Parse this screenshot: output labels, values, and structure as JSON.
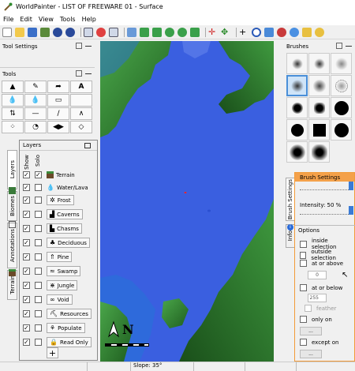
{
  "window": {
    "title": "WorldPainter - LIST OF FREEWARE 01 - Surface"
  },
  "menu": [
    "File",
    "Edit",
    "View",
    "Tools",
    "Help"
  ],
  "panels": {
    "tool_settings": "Tool Settings",
    "tools": "Tools",
    "layers": "Layers",
    "brushes": "Brushes",
    "brush_settings": "Brush Settings"
  },
  "side_tabs": {
    "layers": "Layers",
    "biomes": "Biomes",
    "annotations": "Annotations",
    "terrain": "Terrain"
  },
  "layers_columns": {
    "show": "Show",
    "solo": "Solo"
  },
  "layers": [
    {
      "label": "Terrain",
      "icon": "terrain-block-icon",
      "button": false,
      "show": true,
      "solo": true
    },
    {
      "label": "Water/Lava",
      "icon": "water-drop-icon",
      "button": false,
      "show": true,
      "solo": false
    },
    {
      "label": "Frost",
      "icon": "snowflake-icon",
      "button": true,
      "show": true,
      "solo": false
    },
    {
      "label": "Caverns",
      "icon": "cavern-icon",
      "button": true,
      "show": true,
      "solo": false
    },
    {
      "label": "Chasms",
      "icon": "chasm-icon",
      "button": true,
      "show": true,
      "solo": false
    },
    {
      "label": "Deciduous",
      "icon": "tree-icon",
      "button": true,
      "show": true,
      "solo": false
    },
    {
      "label": "Pine",
      "icon": "pine-icon",
      "button": true,
      "show": true,
      "solo": false
    },
    {
      "label": "Swamp",
      "icon": "swamp-icon",
      "button": true,
      "show": true,
      "solo": false
    },
    {
      "label": "Jungle",
      "icon": "jungle-icon",
      "button": true,
      "show": true,
      "solo": false
    },
    {
      "label": "Void",
      "icon": "void-icon",
      "button": true,
      "show": true,
      "solo": false
    },
    {
      "label": "Resources",
      "icon": "resources-icon",
      "button": true,
      "show": true,
      "solo": false
    },
    {
      "label": "Populate",
      "icon": "populate-icon",
      "button": true,
      "show": true,
      "solo": false
    },
    {
      "label": "Read Only",
      "icon": "lock-icon",
      "button": true,
      "show": true,
      "solo": false
    }
  ],
  "add_layer": "+",
  "brush_settings": {
    "intensity": "Intensity: 50 %",
    "options": "Options",
    "inside_selection": "inside selection",
    "outside_selection": "outside selection",
    "at_or_above": "at or above",
    "at_or_above_value": "0",
    "at_or_below": "at or below",
    "at_or_below_value": "255",
    "feather": "feather",
    "only_on": "only on",
    "only_on_value": "...",
    "except_on": "except on",
    "except_on_value": "..."
  },
  "info_tab": "Info",
  "status": {
    "slope": "Slope: 35°"
  },
  "map": {
    "compass": "N",
    "colors": {
      "water": "#3a5fe0",
      "land_green": "#2f8a2f",
      "land_dark": "#1c5a1c",
      "beach": "#d8c8a0"
    }
  }
}
